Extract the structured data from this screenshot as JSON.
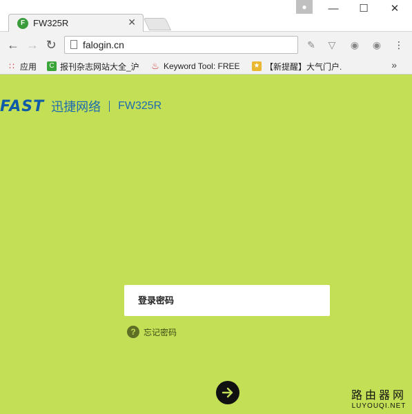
{
  "browser": {
    "tab_title": "FW325R",
    "tab_favicon_letter": "F",
    "tab_close": "✕",
    "url": "falogin.cn",
    "window_controls": {
      "minimize": "—",
      "maximize": "☐",
      "close": "✕"
    },
    "bookmarks": [
      {
        "label": "应用",
        "icon": "apps-grid-icon"
      },
      {
        "label": "报刊杂志网站大全_沪",
        "icon": "green-c-icon"
      },
      {
        "label": "Keyword Tool: FREE",
        "icon": "flame-icon"
      },
      {
        "label": "【新提醒】大气门户.",
        "icon": "trophy-icon"
      }
    ],
    "bookmarks_overflow": "»"
  },
  "page": {
    "brand_logo": "FAST",
    "brand_name": "迅捷网络",
    "model": "FW325R",
    "password_placeholder": "登录密码",
    "forgot_password": "忘记密码",
    "accent_color": "#c2df56"
  },
  "watermark": {
    "cn": "路由器网",
    "en": "LUYOUQI.NET"
  }
}
